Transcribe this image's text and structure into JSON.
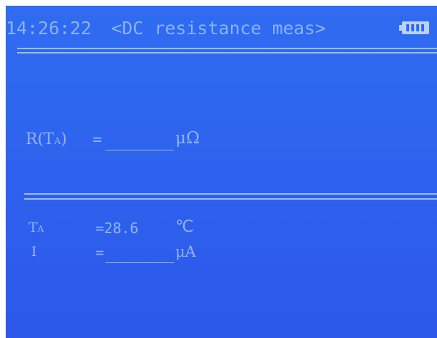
{
  "header": {
    "time": "14:26:22",
    "title": "<DC resistance meas>",
    "battery_icon": "battery-full-icon"
  },
  "resistance": {
    "label_main": "R(T",
    "label_sub": "A",
    "label_close": ")",
    "equals": "=",
    "value": "",
    "unit": "μΩ"
  },
  "temperature": {
    "label_main": "T",
    "label_sub": "A",
    "value": "=28.6",
    "unit": "℃"
  },
  "current": {
    "label": "I",
    "equals": "=",
    "value": "",
    "unit": "μA"
  },
  "colors": {
    "background": "#2e63ee",
    "text": "#8fb4ff",
    "lines": "#9cbcff"
  }
}
